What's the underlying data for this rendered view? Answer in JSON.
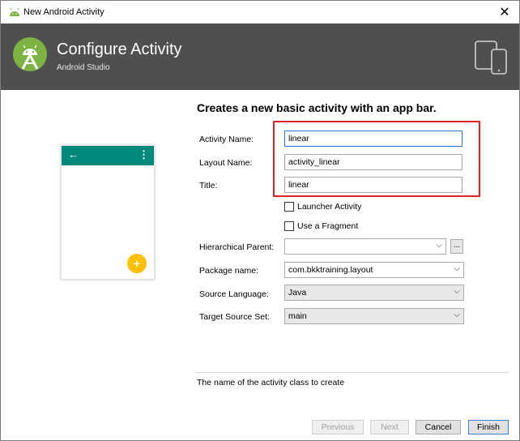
{
  "window": {
    "title": "New Android Activity",
    "close_glyph": "✕"
  },
  "header": {
    "title": "Configure Activity",
    "subtitle": "Android Studio",
    "logo_icon": "android-studio-icon",
    "devices_icon": "devices-icon"
  },
  "main": {
    "heading": "Creates a new basic activity with an app bar.",
    "preview": {
      "back_glyph": "←",
      "menu_glyph": "⋮",
      "fab_glyph": "+",
      "appbar_color": "#00897b",
      "fab_color": "#ffc107"
    },
    "fields": {
      "activity_name": {
        "label": "Activity Name:",
        "value": "linear"
      },
      "layout_name": {
        "label": "Layout Name:",
        "value": "activity_linear"
      },
      "title": {
        "label": "Title:",
        "value": "linear"
      },
      "launcher_activity": {
        "label": "Launcher Activity",
        "checked": false
      },
      "use_fragment": {
        "label": "Use a Fragment",
        "checked": false
      },
      "hierarchical_parent": {
        "label": "Hierarchical Parent:",
        "value": "",
        "browse_label": "..."
      },
      "package_name": {
        "label": "Package name:",
        "value": "com.bkktraining.layout"
      },
      "source_language": {
        "label": "Source Language:",
        "value": "Java"
      },
      "target_source_set": {
        "label": "Target Source Set:",
        "value": "main"
      }
    },
    "help_text": "The name of the activity class to create",
    "highlight_color": "#e0222b"
  },
  "footer": {
    "previous": "Previous",
    "next": "Next",
    "cancel": "Cancel",
    "finish": "Finish"
  }
}
